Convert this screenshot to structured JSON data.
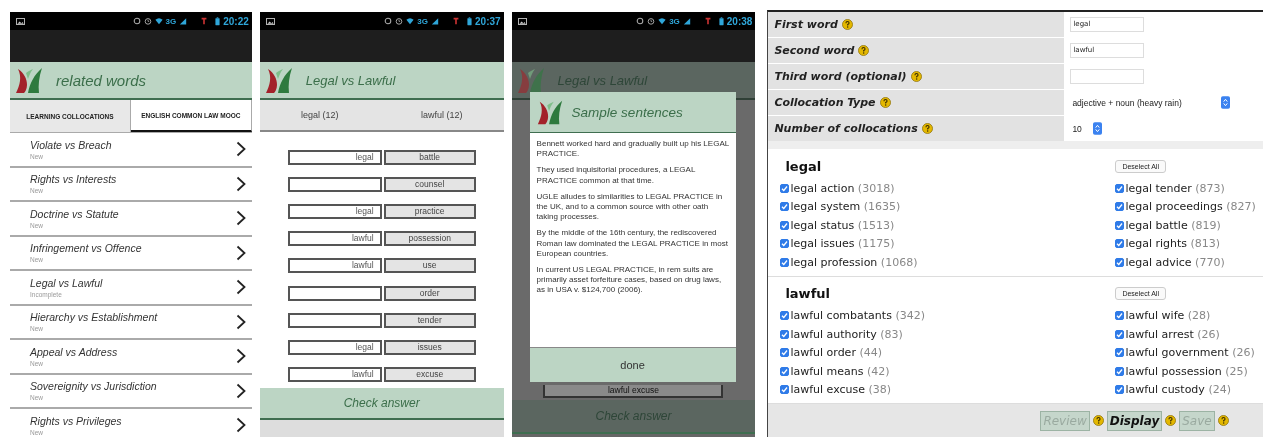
{
  "list_screen": {
    "status_bar": {
      "network": "3G",
      "time": "20:22"
    },
    "title": "related words",
    "tabs": [
      {
        "label": "LEARNING COLLOCATIONS",
        "selected": false
      },
      {
        "label": "ENGLISH COMMON LAW MOOC",
        "selected": true
      }
    ],
    "items": [
      {
        "title": "Violate vs Breach",
        "status": "New"
      },
      {
        "title": "Rights vs Interests",
        "status": "New"
      },
      {
        "title": "Doctrine vs Statute",
        "status": "New"
      },
      {
        "title": "Infringement vs Offence",
        "status": "New"
      },
      {
        "title": "Legal vs Lawful",
        "status": "Incomplete"
      },
      {
        "title": "Hierarchy vs Establishment",
        "status": "New"
      },
      {
        "title": "Appeal vs Address",
        "status": "New"
      },
      {
        "title": "Sovereignity vs Jurisdiction",
        "status": "New"
      },
      {
        "title": "Rights vs Privileges",
        "status": "New"
      }
    ]
  },
  "quiz_screen": {
    "status_bar": {
      "network": "3G",
      "time": "20:37"
    },
    "title": "Legal vs Lawful",
    "tabs": [
      {
        "label": "legal (12)"
      },
      {
        "label": "lawful (12)"
      }
    ],
    "rows": [
      {
        "answer": "legal",
        "word": "battle"
      },
      {
        "word": "counsel"
      },
      {
        "answer": "legal",
        "word": "practice"
      },
      {
        "answer": "lawful",
        "word": "possession"
      },
      {
        "answer": "lawful",
        "word": "use"
      },
      {
        "word": "order"
      },
      {
        "word": "tender"
      },
      {
        "answer": "legal",
        "word": "issues"
      },
      {
        "answer": "lawful",
        "word": "excuse"
      }
    ],
    "button": "Check answer"
  },
  "dialog_screen": {
    "status_bar": {
      "network": "3G",
      "time": "20:38"
    },
    "background": {
      "title": "Legal vs Lawful",
      "row_text": "lawful excuse",
      "button": "Check answer"
    },
    "dialog": {
      "title": "Sample sentences",
      "sentences": [
        "Bennett worked hard and gradually built up his LEGAL PRACTICE.",
        "They used inquisitorial procedures, a LEGAL PRACTICE common at that time.",
        "UGLE alludes to similarities to LEGAL PRACTICE in the UK, and to a common source with other oath taking processes.",
        "By the middle of the 16th  century, the rediscovered Roman law dominated the LEGAL PRACTICE in most European countries.",
        "In current US LEGAL PRACTICE, in rem suits are primarily asset forfeiture cases, based on drug laws, as in USA v. $124,700 (2006)."
      ],
      "button": "done"
    }
  },
  "collocation_form": {
    "fields": [
      {
        "label": "First word",
        "kind": "text",
        "value": "legal"
      },
      {
        "label": "Second word",
        "kind": "text",
        "value": "lawful"
      },
      {
        "label": "Third word (optional)",
        "kind": "text"
      },
      {
        "label": "Collocation Type",
        "kind": "select",
        "value": "adjective + noun (heavy rain)"
      },
      {
        "label": "Number of collocations",
        "kind": "number",
        "value": "10"
      }
    ],
    "groups": [
      {
        "heading": "legal",
        "button": "Deselect All",
        "items": [
          {
            "text": "legal action",
            "count": "(3018)",
            "checked": true
          },
          {
            "text": "legal system",
            "count": "(1635)",
            "checked": true
          },
          {
            "text": "legal status",
            "count": "(1513)",
            "checked": true
          },
          {
            "text": "legal issues",
            "count": "(1175)",
            "checked": true
          },
          {
            "text": "legal profession",
            "count": "(1068)",
            "checked": true
          },
          {
            "text": "legal tender",
            "count": "(873)",
            "checked": true
          },
          {
            "text": "legal proceedings",
            "count": "(827)",
            "checked": true
          },
          {
            "text": "legal battle",
            "count": "(819)",
            "checked": true
          },
          {
            "text": "legal rights",
            "count": "(813)",
            "checked": true
          },
          {
            "text": "legal advice",
            "count": "(770)",
            "checked": true
          }
        ]
      },
      {
        "heading": "lawful",
        "button": "Deselect All",
        "items": [
          {
            "text": "lawful combatants",
            "count": "(342)",
            "checked": true
          },
          {
            "text": "lawful authority",
            "count": "(83)",
            "checked": true
          },
          {
            "text": "lawful order",
            "count": "(44)",
            "checked": true
          },
          {
            "text": "lawful means",
            "count": "(42)",
            "checked": true
          },
          {
            "text": "lawful excuse",
            "count": "(38)",
            "checked": true
          },
          {
            "text": "lawful wife",
            "count": "(28)",
            "checked": true
          },
          {
            "text": "lawful arrest",
            "count": "(26)",
            "checked": true
          },
          {
            "text": "lawful government",
            "count": "(26)",
            "checked": true
          },
          {
            "text": "lawful possession",
            "count": "(25)",
            "checked": true
          },
          {
            "text": "lawful custody",
            "count": "(24)",
            "checked": true
          }
        ]
      }
    ],
    "buttons": [
      {
        "label": "Review",
        "disabled": true
      },
      {
        "label": "Display",
        "disabled": false
      },
      {
        "label": "Save",
        "disabled": true
      }
    ]
  }
}
